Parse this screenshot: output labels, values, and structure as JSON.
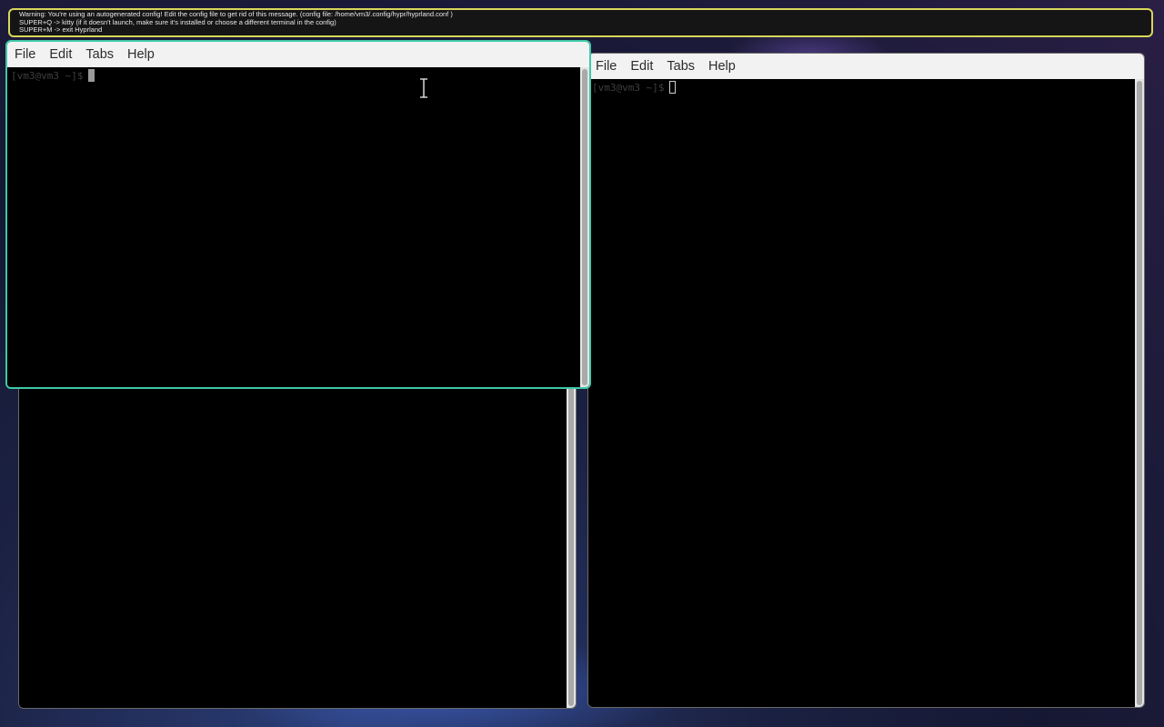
{
  "banner": {
    "lines": [
      "Warning: You're using an autogenerated config! Edit the config file to get rid of this message. (config file: /home/vm3/.config/hypr/hyprland.conf )",
      "SUPER+Q -> kitty (if it doesn't launch, make sure it's installed or choose a different terminal in the config)",
      "SUPER+M -> exit Hyprland"
    ],
    "border_color": "#d8d65a"
  },
  "terminal_active": {
    "menu": [
      "File",
      "Edit",
      "Tabs",
      "Help"
    ],
    "prompt": "[vm3@vm3 ~]$",
    "border_color": "#3ec8a8"
  },
  "terminal_right": {
    "menu": [
      "File",
      "Edit",
      "Tabs",
      "Help"
    ],
    "prompt": "[vm3@vm3 ~]$"
  },
  "terminal_bottom_left": {
    "prompt": ""
  },
  "icons": {
    "mouse_cursor": "i-beam-cursor-icon"
  }
}
